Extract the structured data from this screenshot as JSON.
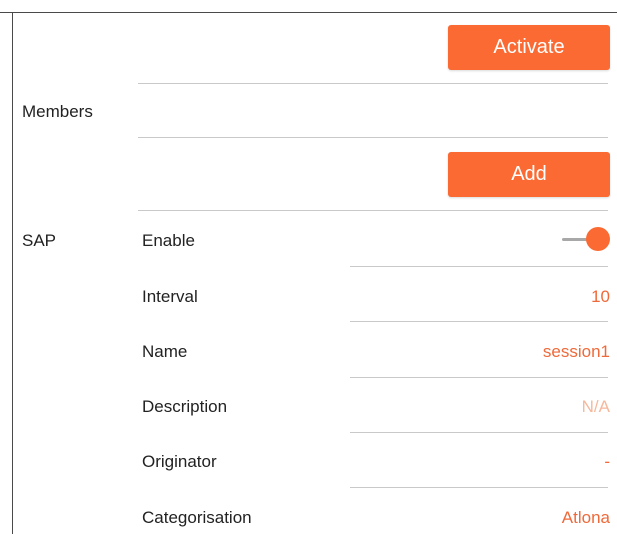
{
  "buttons": {
    "activate": "Activate",
    "add": "Add"
  },
  "sections": {
    "members": "Members",
    "sap": "SAP"
  },
  "sap_fields": {
    "enable": {
      "label": "Enable",
      "value": true
    },
    "interval": {
      "label": "Interval",
      "value": "10"
    },
    "name": {
      "label": "Name",
      "value": "session1"
    },
    "description": {
      "label": "Description",
      "value": "N/A"
    },
    "originator": {
      "label": "Originator",
      "value": "-"
    },
    "categorisation": {
      "label": "Categorisation",
      "value": "Atlona"
    }
  },
  "colors": {
    "accent": "#fa6a32",
    "value_text": "#ee6a3a",
    "placeholder_text": "#f6b89d",
    "divider": "#c9c9c9"
  }
}
